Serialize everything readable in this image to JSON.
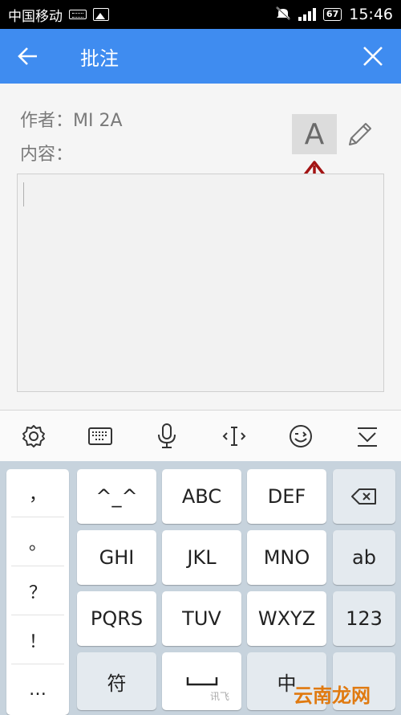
{
  "status_bar": {
    "carrier": "中国移动",
    "battery": "67",
    "time": "15:46"
  },
  "app_bar": {
    "title": "批注",
    "back_icon": "arrow-left-icon",
    "close_icon": "close-icon"
  },
  "form": {
    "author_label": "作者：",
    "author_value": "MI 2A",
    "content_label": "内容：",
    "font_button_label": "A",
    "content_value": ""
  },
  "toolbar": {
    "icons": [
      "gear-icon",
      "keyboard-icon",
      "microphone-icon",
      "cursor-move-icon",
      "emoji-icon",
      "collapse-keyboard-icon"
    ]
  },
  "keyboard": {
    "punctuation": [
      "，",
      "。",
      "？",
      "！",
      "…"
    ],
    "keys": {
      "k1": "^_^",
      "k2": "ABC",
      "k3": "DEF",
      "k4": "GHI",
      "k5": "JKL",
      "k6": "MNO",
      "k7": "PQRS",
      "k8": "TUV",
      "k9": "WXYZ",
      "symbol": "符",
      "lang": "中",
      "case": "ab",
      "numbers": "123"
    },
    "brand": "讯飞"
  },
  "watermark": "云南龙网",
  "colors": {
    "app_bar": "#3f8cf0",
    "annotation_arrow": "#a31414",
    "keyboard_bg": "#c7d3dd"
  }
}
